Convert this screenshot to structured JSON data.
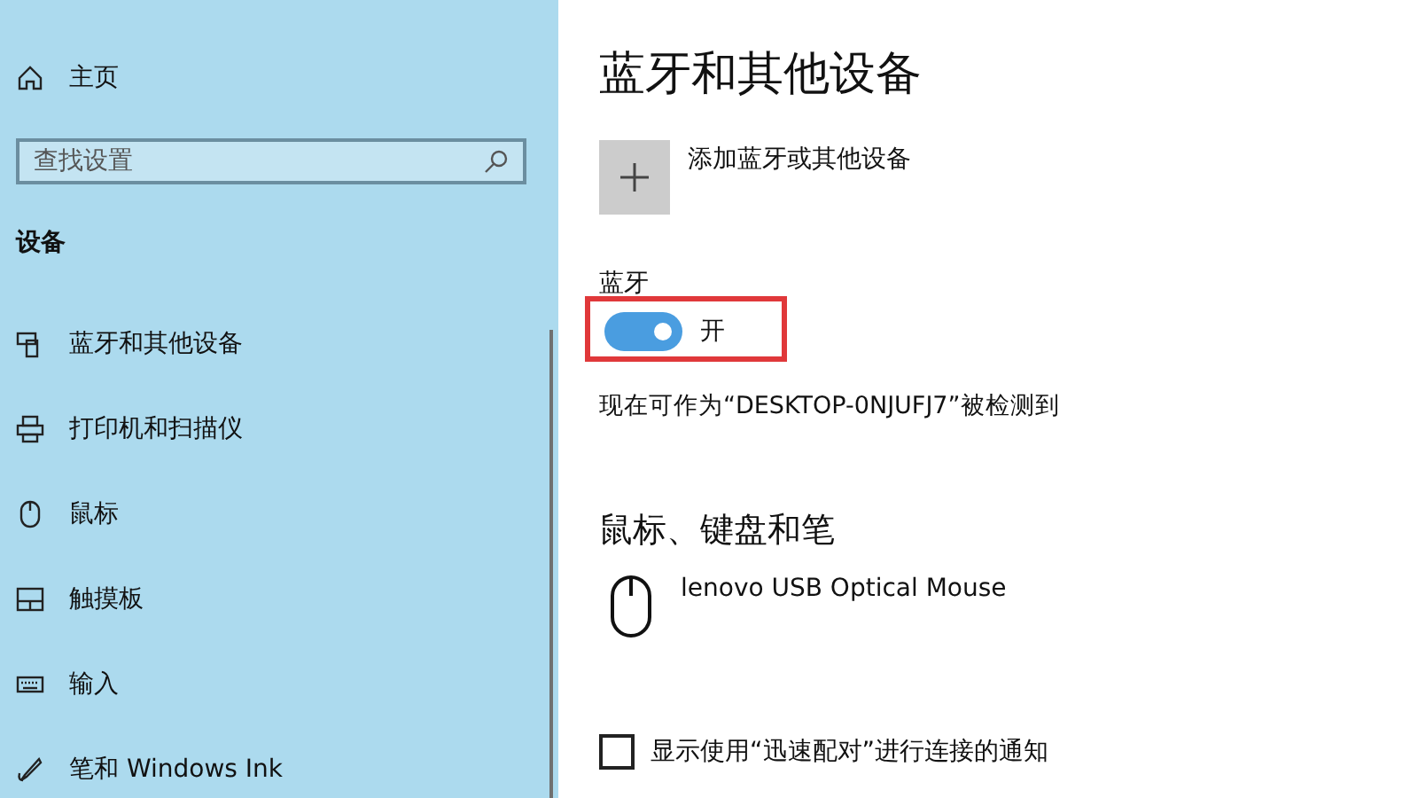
{
  "sidebar": {
    "home": "主页",
    "search": {
      "placeholder": "查找设置"
    },
    "section": "设备",
    "items": [
      {
        "label": "蓝牙和其他设备",
        "kind": "bluetooth"
      },
      {
        "label": "打印机和扫描仪",
        "kind": "printer"
      },
      {
        "label": "鼠标",
        "kind": "mouse"
      },
      {
        "label": "触摸板",
        "kind": "touchpad"
      },
      {
        "label": "输入",
        "kind": "keyboard"
      },
      {
        "label": "笔和 Windows Ink",
        "kind": "pen"
      }
    ]
  },
  "main": {
    "title": "蓝牙和其他设备",
    "add_device": "添加蓝牙或其他设备",
    "bluetooth": {
      "label": "蓝牙",
      "on": true,
      "state": "开",
      "highlighted": true
    },
    "discoverable": "现在可作为“DESKTOP-0NJUFJ7”被检测到",
    "devices_heading": "鼠标、键盘和笔",
    "devices": [
      {
        "name": "lenovo USB Optical Mouse"
      }
    ],
    "swift_pair": {
      "label": "显示使用“迅速配对”进行连接的通知",
      "checked": false
    }
  }
}
